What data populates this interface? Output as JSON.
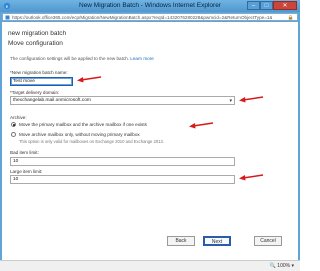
{
  "window": {
    "title": "New Migration Batch - Windows Internet Explorer",
    "controls": {
      "minimize": "–",
      "maximize": "□",
      "close": "✕"
    }
  },
  "address": {
    "url": "https://outlook.office365.com/ecp/Migration/NewMigrationBatch.aspx?reqId=1432076280228&pwmcid=2&ReturnObjectType=1&tar"
  },
  "page": {
    "breadcrumb": "new migration batch",
    "heading": "Move configuration",
    "info_text": "The configuration settings will be applied to the new batch.",
    "learn_more": "Learn more"
  },
  "form": {
    "batch_name_label": "*New migration batch name:",
    "batch_name_value": "Test move",
    "domain_label": "*Target delivery domain:",
    "domain_value": "thexchangelab.mail.onmicrosoft.com",
    "archive_label": "Archive:",
    "archive_options": [
      {
        "label": "Move the primary mailbox and the archive mailbox if one exists",
        "selected": true
      },
      {
        "label": "Move archive mailbox only, without moving primary mailbox",
        "selected": false
      }
    ],
    "archive_note": "This option is only valid for mailboxes on Exchange 2010 and Exchange 2013.",
    "bad_item_label": "Bad item limit:",
    "bad_item_value": "10",
    "large_item_label": "Large item limit:",
    "large_item_value": "10"
  },
  "buttons": {
    "back": "Back",
    "next": "Next",
    "cancel": "Cancel"
  },
  "statusbar": {
    "zoom": "100%"
  },
  "colors": {
    "arrow": "#d71a1a",
    "primary_border": "#2a5caa",
    "titlebar": "#5fa5d8"
  }
}
